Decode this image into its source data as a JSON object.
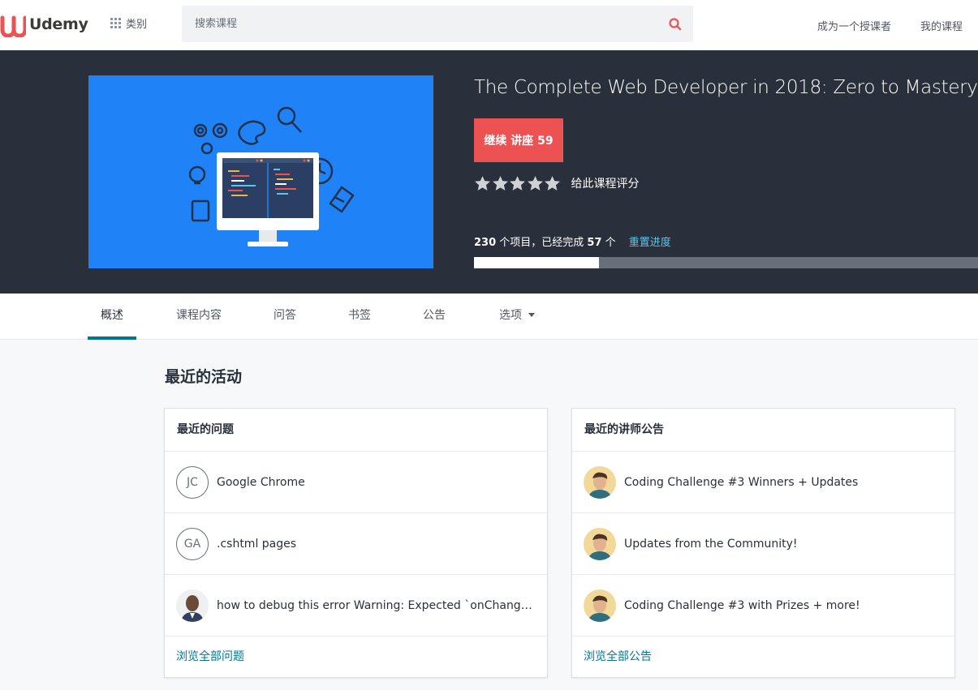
{
  "brand": {
    "name": "Udemy"
  },
  "nav": {
    "categories_label": "类别",
    "search_placeholder": "搜索课程",
    "teach_label": "成为一个授课者",
    "my_courses_label": "我的课程"
  },
  "course": {
    "title": "The Complete Web Developer in 2018: Zero to Mastery",
    "continue_label": "继续 讲座 59",
    "rating_label": "给此课程评分",
    "stars": 5,
    "progress": {
      "total_items": "230",
      "items_text": " 个项目，已经完成 ",
      "completed": "57",
      "unit": " 个",
      "reset_label": "重置进度",
      "fraction": 0.248
    }
  },
  "tabs": [
    {
      "label": "概述",
      "active": true
    },
    {
      "label": "课程内容"
    },
    {
      "label": "问答"
    },
    {
      "label": "书签"
    },
    {
      "label": "公告"
    },
    {
      "label": "选项"
    }
  ],
  "activity": {
    "title": "最近的活动",
    "questions": {
      "header": "最近的问题",
      "items": [
        {
          "initials": "JC",
          "text": "Google Chrome"
        },
        {
          "initials": "GA",
          "text": ".cshtml pages"
        },
        {
          "initials": "",
          "text": "how to debug this error Warning: Expected `onChange` listener to be a function"
        }
      ],
      "footer": "浏览全部问题"
    },
    "announcements": {
      "header": "最近的讲师公告",
      "items": [
        {
          "text": "Coding Challenge #3 Winners + Updates"
        },
        {
          "text": "Updates from the Community!"
        },
        {
          "text": "Coding Challenge #3 with Prizes + more!"
        }
      ],
      "footer": "浏览全部公告"
    }
  },
  "colors": {
    "brand": "#ec5252",
    "hero_bg": "#29303b",
    "image_bg": "#1f83f7",
    "link": "#007791",
    "reset_link": "#5ec4e8"
  }
}
